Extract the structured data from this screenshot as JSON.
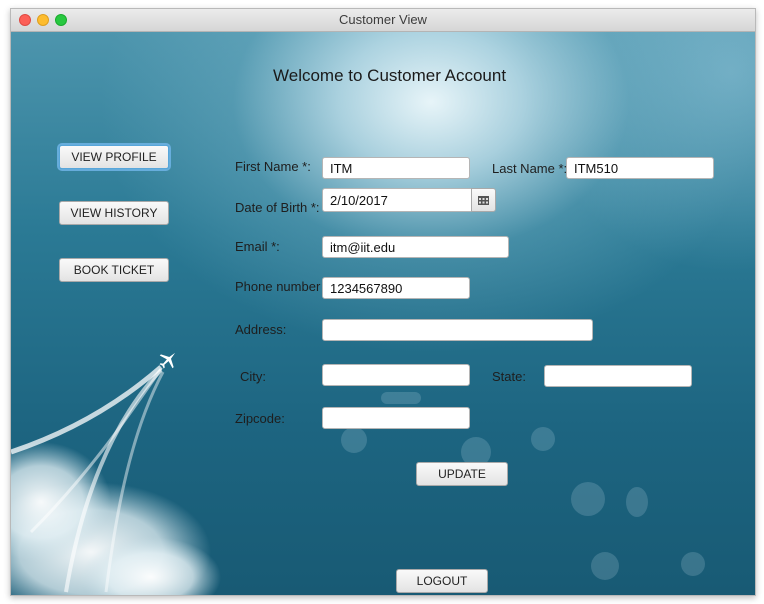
{
  "window": {
    "title": "Customer View"
  },
  "heading": "Welcome to Customer Account",
  "nav": {
    "view_profile": "VIEW PROFILE",
    "view_history": "VIEW HISTORY",
    "book_ticket": "BOOK TICKET"
  },
  "form": {
    "first_name": {
      "label": "First Name *:",
      "value": "ITM"
    },
    "last_name": {
      "label": "Last Name *:",
      "value": "ITM510"
    },
    "dob": {
      "label": "Date of Birth *:",
      "value": "2/10/2017"
    },
    "email": {
      "label": "Email *:",
      "value": "itm@iit.edu"
    },
    "phone": {
      "label": "Phone number *",
      "value": "1234567890"
    },
    "address": {
      "label": "Address:",
      "value": ""
    },
    "city": {
      "label": "City:",
      "value": ""
    },
    "state": {
      "label": "State:",
      "value": ""
    },
    "zipcode": {
      "label": "Zipcode:",
      "value": ""
    }
  },
  "buttons": {
    "update": "UPDATE",
    "logout": "LOGOUT"
  },
  "icons": {
    "calendar": "calendar-icon",
    "airplane": "airplane-icon"
  },
  "colors": {
    "background": "#1d6581",
    "focus_ring": "#58a6da"
  }
}
